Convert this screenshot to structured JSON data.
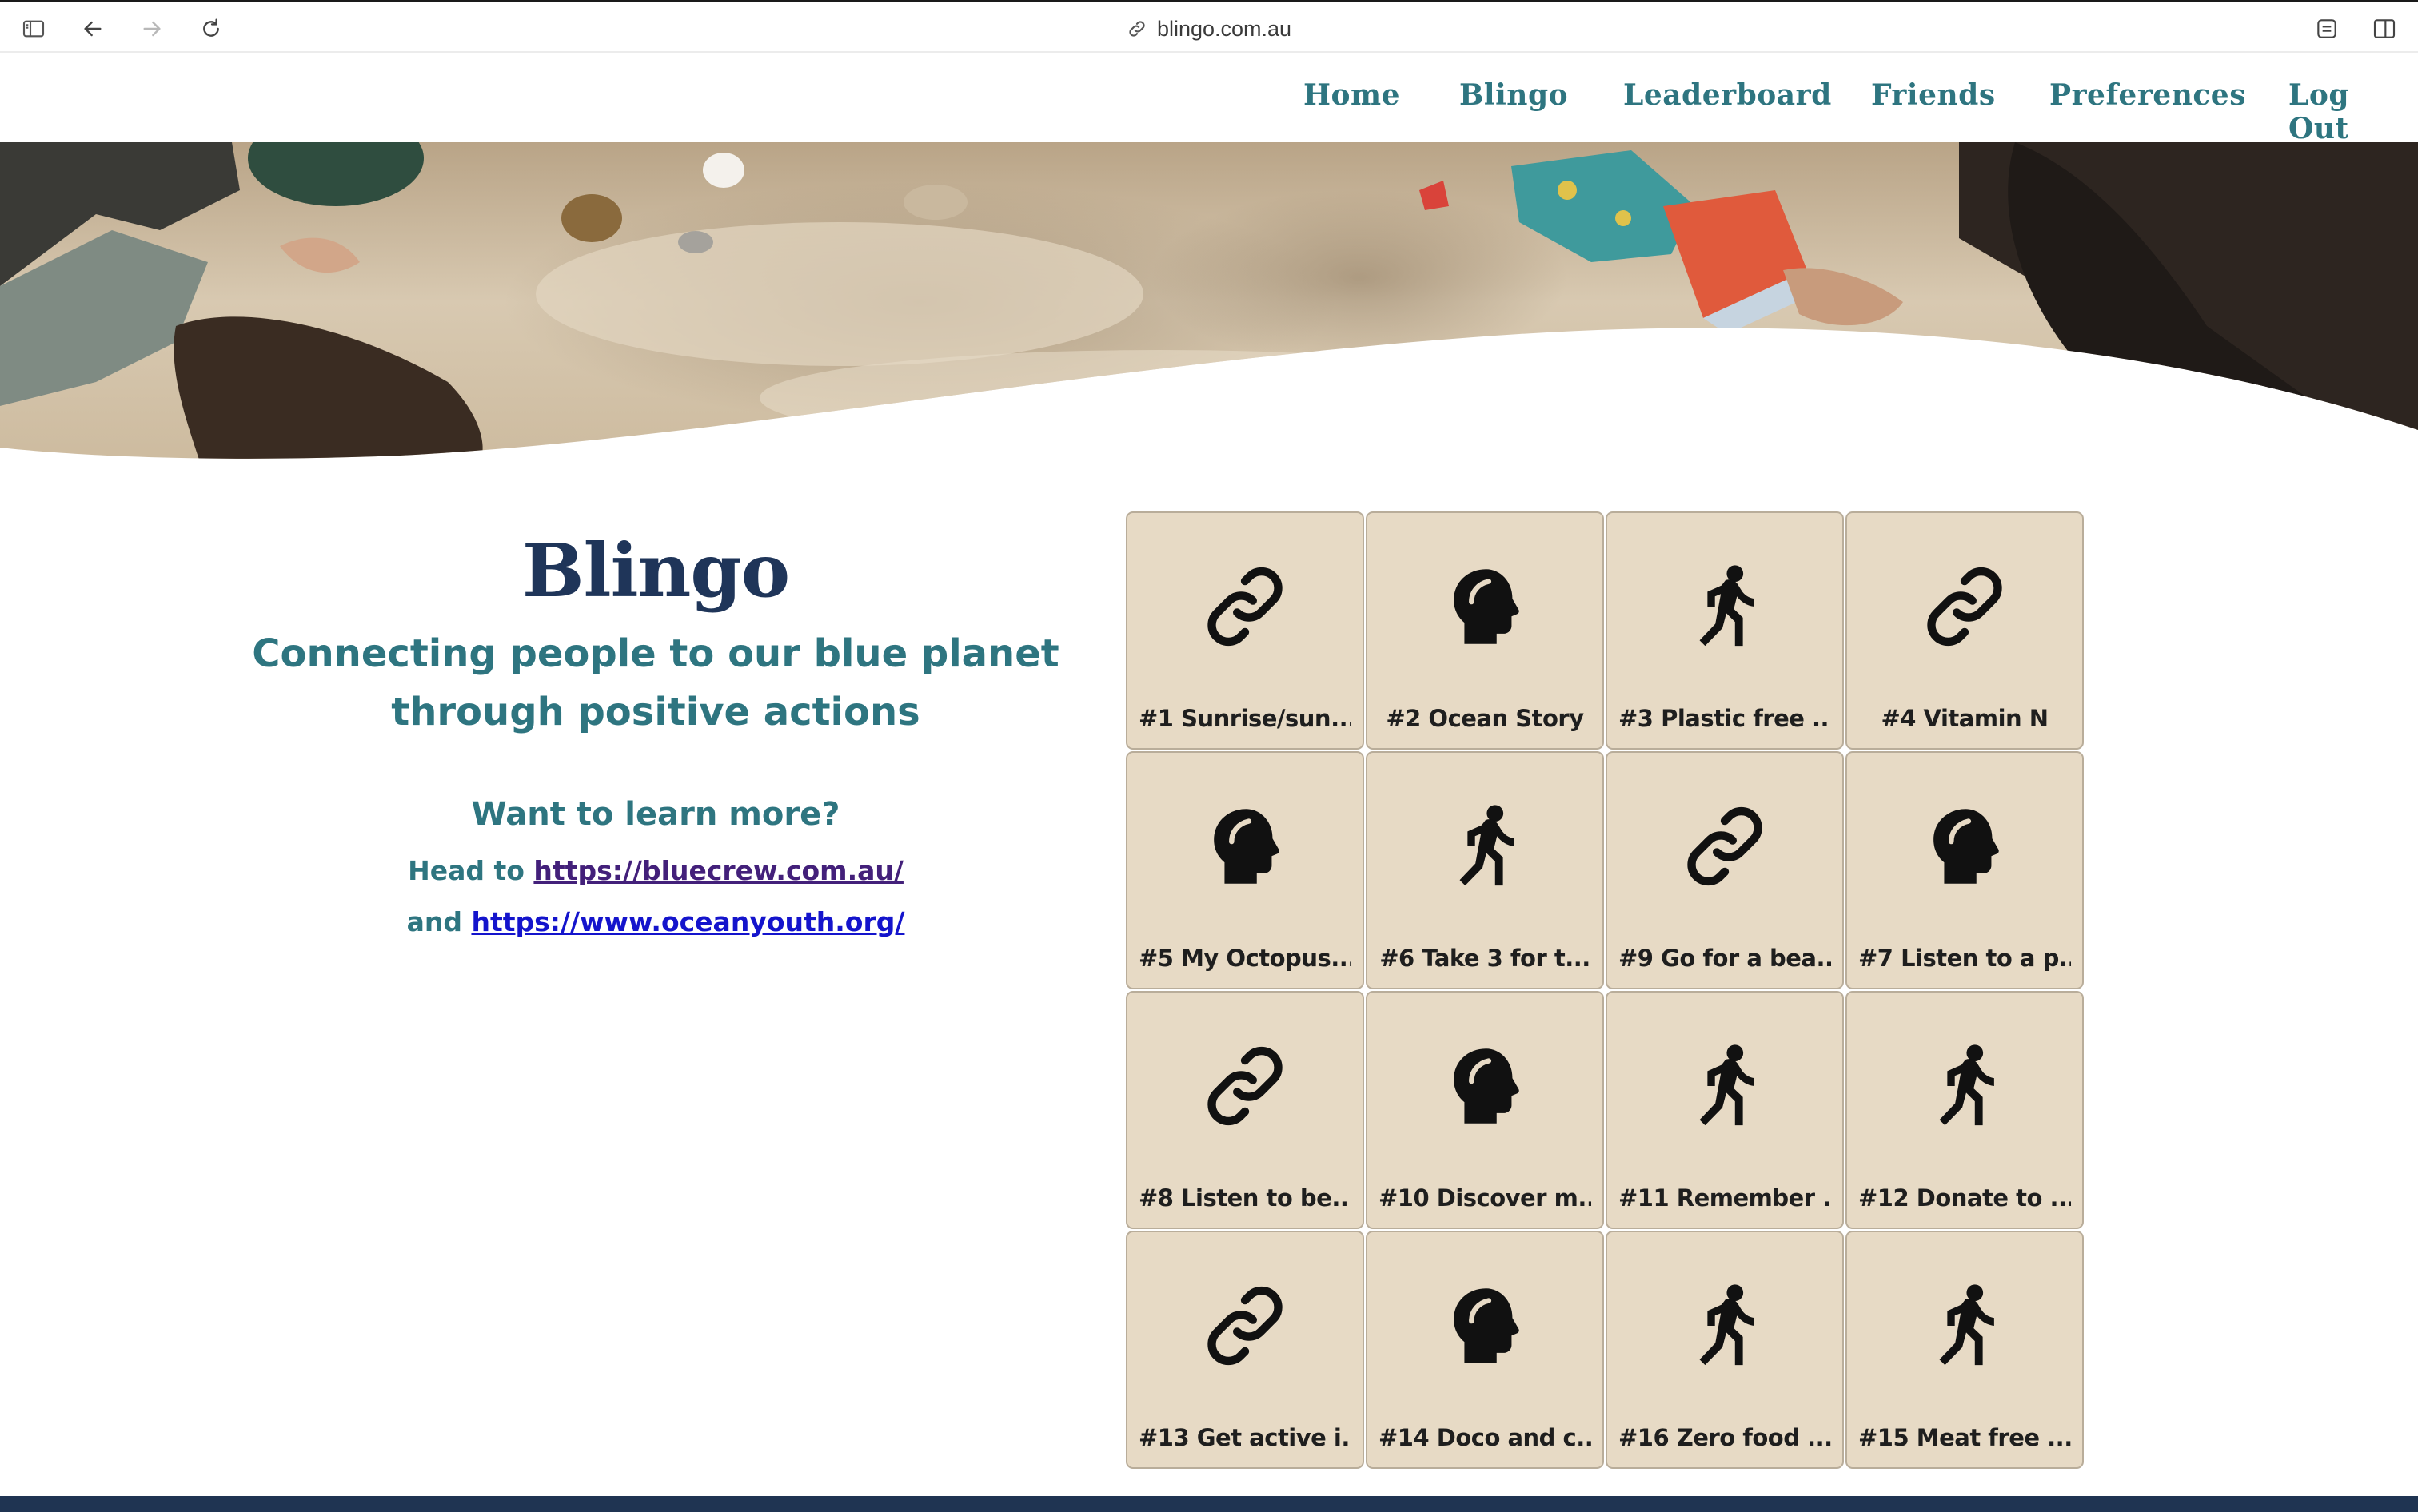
{
  "browser": {
    "url": "blingo.com.au"
  },
  "nav": {
    "items": [
      "Home",
      "Blingo",
      "Leaderboard",
      "Friends",
      "Preferences",
      "Log Out"
    ]
  },
  "hero": {
    "image": "beach-sand-hero-photo"
  },
  "intro": {
    "title": "Blingo",
    "tagline_line1": "Connecting people to our blue planet",
    "tagline_line2": "through positive actions",
    "learn_more": "Want to learn more?",
    "head_to": "Head to",
    "link1": "https://bluecrew.com.au/",
    "and": "and",
    "link2": "https://www.oceanyouth.org/"
  },
  "colors": {
    "brand_navy": "#1f3559",
    "brand_teal": "#2e7580",
    "tile_bg": "#e7dac5",
    "link_visited": "#43207a",
    "link": "#1414cc"
  },
  "tiles": [
    {
      "icon": "link-icon",
      "label": "#1 Sunrise/sun..."
    },
    {
      "icon": "head-icon",
      "label": "#2 Ocean Story"
    },
    {
      "icon": "walking-icon",
      "label": "#3 Plastic free ..."
    },
    {
      "icon": "link-icon",
      "label": "#4 Vitamin N"
    },
    {
      "icon": "head-icon",
      "label": "#5 My Octopus..."
    },
    {
      "icon": "walking-icon",
      "label": "#6 Take 3 for t..."
    },
    {
      "icon": "link-icon",
      "label": "#9 Go for a bea..."
    },
    {
      "icon": "head-icon",
      "label": "#7 Listen to a p..."
    },
    {
      "icon": "link-icon",
      "label": "#8 Listen to be..."
    },
    {
      "icon": "head-icon",
      "label": "#10 Discover m..."
    },
    {
      "icon": "walking-icon",
      "label": "#11 Remember ..."
    },
    {
      "icon": "walking-icon",
      "label": "#12 Donate to ..."
    },
    {
      "icon": "link-icon",
      "label": "#13 Get active i..."
    },
    {
      "icon": "head-icon",
      "label": "#14 Doco and c..."
    },
    {
      "icon": "walking-icon",
      "label": "#16 Zero food ..."
    },
    {
      "icon": "walking-icon",
      "label": "#15 Meat free ..."
    }
  ]
}
